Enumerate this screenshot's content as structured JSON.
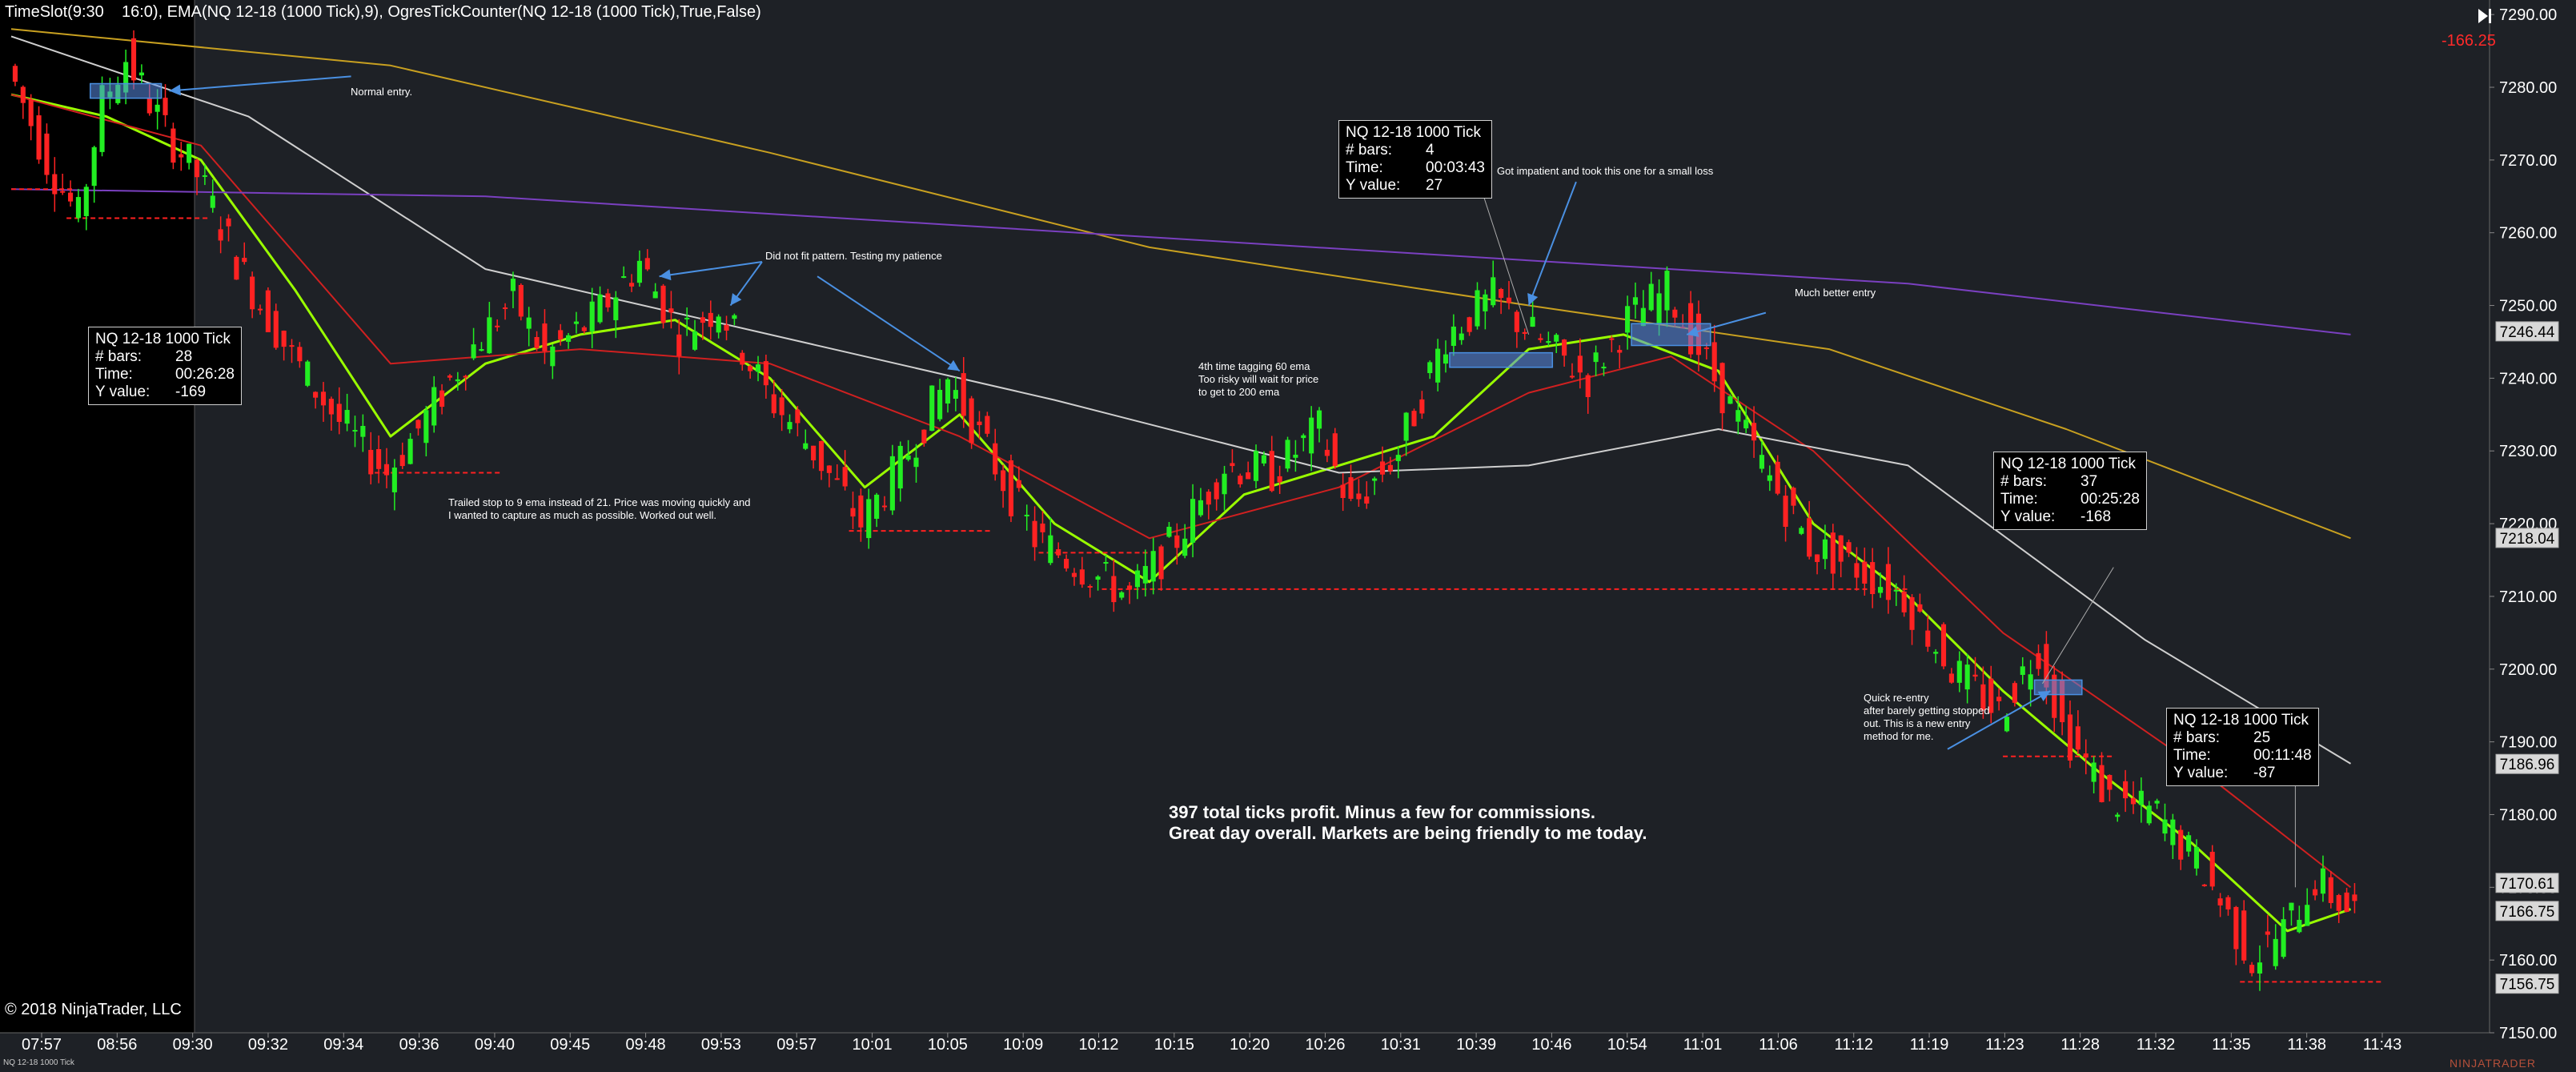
{
  "header": {
    "indicators": "TimeSlot(9:30    16:0), EMA(NQ 12-18 (1000 Tick),9), OgresTickCounter(NQ 12-18 (1000 Tick),True,False)",
    "pnl": "-166.25",
    "copyright": "© 2018 NinjaTrader, LLC",
    "footer_instrument": "NQ 12-18 1000 Tick",
    "logo": "NINJATRADER"
  },
  "colors": {
    "background": "#1e2126",
    "bull_candle": "#22ee22",
    "bear_candle": "#ff2222",
    "ema9": "#9aff00",
    "ema21": "#d02020",
    "ema60": "#cfcfcf",
    "ema200": "#c8a020",
    "ema_long": "#7a40c0",
    "annotation_line": "#4a90e2",
    "level_line": "#ff2020"
  },
  "info_boxes": [
    {
      "title": "NQ 12-18 1000 Tick",
      "bars_label": "# bars:",
      "bars": "28",
      "time_label": "Time:",
      "time": "00:26:28",
      "y_label": "Y value:",
      "y": "-169"
    },
    {
      "title": "NQ 12-18 1000 Tick",
      "bars_label": "# bars:",
      "bars": "4",
      "time_label": "Time:",
      "time": "00:03:43",
      "y_label": "Y value:",
      "y": "27"
    },
    {
      "title": "NQ 12-18 1000 Tick",
      "bars_label": "# bars:",
      "bars": "37",
      "time_label": "Time:",
      "time": "00:25:28",
      "y_label": "Y value:",
      "y": "-168"
    },
    {
      "title": "NQ 12-18 1000 Tick",
      "bars_label": "# bars:",
      "bars": "25",
      "time_label": "Time:",
      "time": "00:11:48",
      "y_label": "Y value:",
      "y": "-87"
    }
  ],
  "notes": {
    "normal_entry": "Normal entry.",
    "did_not_fit": "Did not fit pattern. Testing my patience",
    "impatient": "Got impatient and took this one for a small loss",
    "better_entry": "Much better entry",
    "ema_tag": [
      "4th time tagging 60 ema",
      "Too risky will wait for price",
      "to get to 200 ema"
    ],
    "trailed": [
      "Trailed stop to 9 ema instead of 21. Price was moving quickly and",
      "I wanted to capture as much as possible. Worked out well."
    ],
    "reentry": [
      "Quick re-entry",
      "after barely getting stopped",
      "out. This is a new entry",
      "method for me."
    ]
  },
  "summary": {
    "line1": "397 total ticks profit. Minus a few for commissions.",
    "line2": "Great day overall. Markets are being friendly to me today."
  },
  "chart_data": {
    "type": "candlestick",
    "instrument": "NQ 12-18 (1000 Tick)",
    "ylim": [
      7150,
      7292
    ],
    "y_ticks": [
      7150,
      7160,
      7170,
      7180,
      7190,
      7200,
      7210,
      7220,
      7230,
      7240,
      7250,
      7260,
      7270,
      7280,
      7290
    ],
    "y_tick_labels": [
      "7150.00",
      "7160.00",
      "7170.00",
      "7180.00",
      "7190.00",
      "7200.00",
      "7210.00",
      "7220.00",
      "7230.00",
      "7240.00",
      "7250.00",
      "7260.00",
      "7270.00",
      "7280.00",
      "7290.00"
    ],
    "x_labels": [
      "07:57",
      "08:56",
      "09:30",
      "09:32",
      "09:34",
      "09:36",
      "09:40",
      "09:45",
      "09:48",
      "09:53",
      "09:57",
      "10:01",
      "10:05",
      "10:09",
      "10:12",
      "10:15",
      "10:20",
      "10:26",
      "10:31",
      "10:39",
      "10:46",
      "10:54",
      "11:01",
      "11:06",
      "11:12",
      "11:19",
      "11:23",
      "11:28",
      "11:32",
      "11:35",
      "11:38",
      "11:43"
    ],
    "session_start_label": "09:30",
    "price_markers": [
      {
        "label": "7246.44",
        "value": 7246.44
      },
      {
        "label": "7218.04",
        "value": 7218.04
      },
      {
        "label": "7186.96",
        "value": 7186.96
      },
      {
        "label": "7170.61",
        "value": 7170.61
      },
      {
        "label": "7166.75",
        "value": 7166.75
      },
      {
        "label": "7156.75",
        "value": 7156.75
      }
    ],
    "price_path": [
      [
        0,
        7283
      ],
      [
        5,
        7270
      ],
      [
        9,
        7262
      ],
      [
        12,
        7278
      ],
      [
        15,
        7284
      ],
      [
        20,
        7274
      ],
      [
        24,
        7268
      ],
      [
        30,
        7254
      ],
      [
        36,
        7243
      ],
      [
        42,
        7234
      ],
      [
        48,
        7227
      ],
      [
        52,
        7233
      ],
      [
        58,
        7243
      ],
      [
        64,
        7251
      ],
      [
        68,
        7243
      ],
      [
        74,
        7248
      ],
      [
        80,
        7256
      ],
      [
        85,
        7246
      ],
      [
        90,
        7250
      ],
      [
        96,
        7238
      ],
      [
        102,
        7230
      ],
      [
        108,
        7220
      ],
      [
        113,
        7228
      ],
      [
        119,
        7240
      ],
      [
        124,
        7230
      ],
      [
        130,
        7218
      ],
      [
        136,
        7214
      ],
      [
        142,
        7210
      ],
      [
        148,
        7218
      ],
      [
        154,
        7228
      ],
      [
        160,
        7227
      ],
      [
        166,
        7233
      ],
      [
        170,
        7222
      ],
      [
        176,
        7230
      ],
      [
        182,
        7246
      ],
      [
        188,
        7251
      ],
      [
        194,
        7245
      ],
      [
        200,
        7240
      ],
      [
        205,
        7248
      ],
      [
        210,
        7252
      ],
      [
        216,
        7240
      ],
      [
        222,
        7228
      ],
      [
        228,
        7217
      ],
      [
        234,
        7214
      ],
      [
        240,
        7210
      ],
      [
        246,
        7200
      ],
      [
        252,
        7194
      ],
      [
        257,
        7203
      ],
      [
        260,
        7192
      ],
      [
        266,
        7182
      ],
      [
        272,
        7180
      ],
      [
        278,
        7172
      ],
      [
        284,
        7160
      ],
      [
        288,
        7164
      ],
      [
        292,
        7171
      ],
      [
        296,
        7167
      ]
    ],
    "ema_lines": [
      {
        "period": "9",
        "points": [
          [
            0,
            7279
          ],
          [
            12,
            7276
          ],
          [
            24,
            7270
          ],
          [
            36,
            7252
          ],
          [
            48,
            7232
          ],
          [
            60,
            7242
          ],
          [
            72,
            7246
          ],
          [
            84,
            7248
          ],
          [
            96,
            7240
          ],
          [
            108,
            7225
          ],
          [
            120,
            7235
          ],
          [
            132,
            7220
          ],
          [
            144,
            7212
          ],
          [
            156,
            7224
          ],
          [
            168,
            7228
          ],
          [
            180,
            7232
          ],
          [
            192,
            7244
          ],
          [
            204,
            7246
          ],
          [
            216,
            7241
          ],
          [
            228,
            7220
          ],
          [
            240,
            7210
          ],
          [
            252,
            7197
          ],
          [
            264,
            7186
          ],
          [
            276,
            7176
          ],
          [
            288,
            7164
          ],
          [
            296,
            7167
          ]
        ]
      },
      {
        "period": "21",
        "points": [
          [
            0,
            7279
          ],
          [
            24,
            7272
          ],
          [
            48,
            7242
          ],
          [
            72,
            7244
          ],
          [
            96,
            7242
          ],
          [
            120,
            7232
          ],
          [
            144,
            7218
          ],
          [
            168,
            7225
          ],
          [
            192,
            7238
          ],
          [
            210,
            7243
          ],
          [
            228,
            7230
          ],
          [
            252,
            7205
          ],
          [
            276,
            7187
          ],
          [
            296,
            7170
          ]
        ]
      },
      {
        "period": "60",
        "points": [
          [
            0,
            7287
          ],
          [
            30,
            7276
          ],
          [
            60,
            7255
          ],
          [
            96,
            7246
          ],
          [
            132,
            7237
          ],
          [
            168,
            7227
          ],
          [
            192,
            7228
          ],
          [
            216,
            7233
          ],
          [
            240,
            7228
          ],
          [
            270,
            7204
          ],
          [
            296,
            7187
          ]
        ]
      },
      {
        "period": "200",
        "points": [
          [
            0,
            7288
          ],
          [
            48,
            7283
          ],
          [
            96,
            7271
          ],
          [
            144,
            7258
          ],
          [
            192,
            7250
          ],
          [
            230,
            7244
          ],
          [
            260,
            7233
          ],
          [
            296,
            7218
          ]
        ]
      },
      {
        "period": "long",
        "points": [
          [
            0,
            7266
          ],
          [
            60,
            7265
          ],
          [
            120,
            7261
          ],
          [
            180,
            7257
          ],
          [
            240,
            7253
          ],
          [
            296,
            7246
          ]
        ]
      }
    ],
    "level_lines": [
      {
        "y": 7266,
        "x0": 0,
        "x1": 8
      },
      {
        "y": 7262,
        "x0": 7,
        "x1": 25
      },
      {
        "y": 7227,
        "x0": 46,
        "x1": 62
      },
      {
        "y": 7219,
        "x0": 106,
        "x1": 124
      },
      {
        "y": 7216,
        "x0": 130,
        "x1": 146
      },
      {
        "y": 7211,
        "x0": 138,
        "x1": 240
      },
      {
        "y": 7188,
        "x0": 252,
        "x1": 266
      },
      {
        "y": 7157,
        "x0": 282,
        "x1": 300
      }
    ],
    "entry_boxes": [
      {
        "x0": 10,
        "x1": 19,
        "y0": 7278.5,
        "y1": 7280.5
      },
      {
        "x0": 182,
        "x1": 195,
        "y0": 7241.5,
        "y1": 7243.5
      },
      {
        "x0": 205,
        "x1": 215,
        "y0": 7244.5,
        "y1": 7247.5
      },
      {
        "x0": 256,
        "x1": 262,
        "y0": 7196.5,
        "y1": 7198.5
      }
    ],
    "annotation_arrows": [
      {
        "from": [
          43,
          7281.5
        ],
        "to": [
          20,
          7279.5
        ]
      },
      {
        "from": [
          95,
          7256
        ],
        "to": [
          82,
          7254
        ]
      },
      {
        "from": [
          95,
          7256
        ],
        "to": [
          91,
          7250
        ]
      },
      {
        "from": [
          102,
          7254
        ],
        "to": [
          120,
          7241
        ]
      },
      {
        "from": [
          198,
          7267
        ],
        "to": [
          192,
          7250
        ]
      },
      {
        "from": [
          222,
          7249
        ],
        "to": [
          212,
          7246
        ]
      },
      {
        "from": [
          245,
          7189
        ],
        "to": [
          258,
          7197
        ]
      }
    ],
    "leader_lines": [
      {
        "from": [
          186,
          7266
        ],
        "to": [
          192,
          7246
        ]
      },
      {
        "from": [
          266,
          7214
        ],
        "to": [
          257,
          7198
        ]
      },
      {
        "from": [
          289,
          7184
        ],
        "to": [
          289,
          7170
        ]
      }
    ]
  }
}
